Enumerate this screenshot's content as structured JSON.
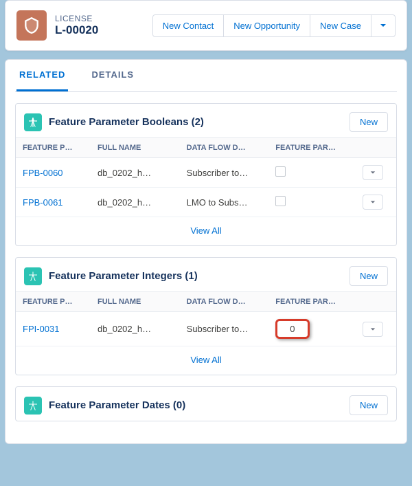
{
  "header": {
    "object_label": "LICENSE",
    "record_name": "L-00020",
    "actions": [
      "New Contact",
      "New Opportunity",
      "New Case"
    ]
  },
  "tabs": [
    {
      "label": "RELATED",
      "active": true
    },
    {
      "label": "DETAILS",
      "active": false
    }
  ],
  "related": {
    "new_label": "New",
    "view_all_label": "View All",
    "columns": {
      "id": "FEATURE P…",
      "fullname": "FULL NAME",
      "dataflow": "DATA FLOW D…",
      "value": "FEATURE PAR…"
    },
    "booleans": {
      "title": "Feature Parameter Booleans (2)",
      "rows": [
        {
          "id": "FPB-0060",
          "fullname": "db_0202_h…",
          "dataflow": "Subscriber to…",
          "value": false
        },
        {
          "id": "FPB-0061",
          "fullname": "db_0202_h…",
          "dataflow": "LMO to Subs…",
          "value": false
        }
      ]
    },
    "integers": {
      "title": "Feature Parameter Integers (1)",
      "rows": [
        {
          "id": "FPI-0031",
          "fullname": "db_0202_h…",
          "dataflow": "Subscriber to…",
          "value": "0"
        }
      ]
    },
    "dates": {
      "title": "Feature Parameter Dates (0)",
      "rows": []
    }
  }
}
